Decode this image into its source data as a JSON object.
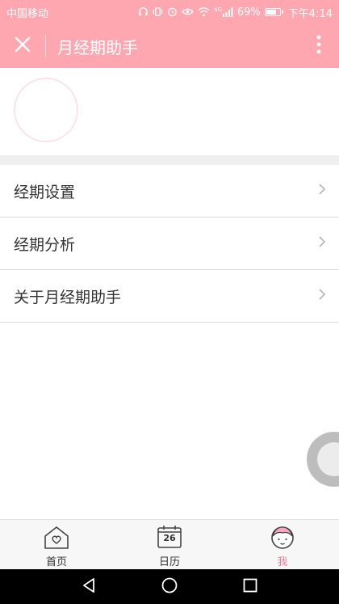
{
  "status_bar": {
    "carrier": "中国移动",
    "signal_label": "4G",
    "battery": "69%",
    "battery_level": 0.69,
    "time": "下午4:14"
  },
  "header": {
    "title": "月经期助手",
    "close_icon": "close-icon",
    "more_icon": "more-vertical-icon"
  },
  "menu": {
    "items": [
      {
        "label": "经期设置"
      },
      {
        "label": "经期分析"
      },
      {
        "label": "关于月经期助手"
      }
    ]
  },
  "tabs": [
    {
      "label": "首页",
      "icon": "home-heart-icon",
      "active": false
    },
    {
      "label": "日历",
      "icon": "calendar-icon",
      "day": "26",
      "active": false
    },
    {
      "label": "我",
      "icon": "girl-avatar-icon",
      "active": true
    }
  ],
  "colors": {
    "brand": "#fea7b0",
    "accent_text": "#f37e92",
    "divider": "#dcdcdc"
  }
}
